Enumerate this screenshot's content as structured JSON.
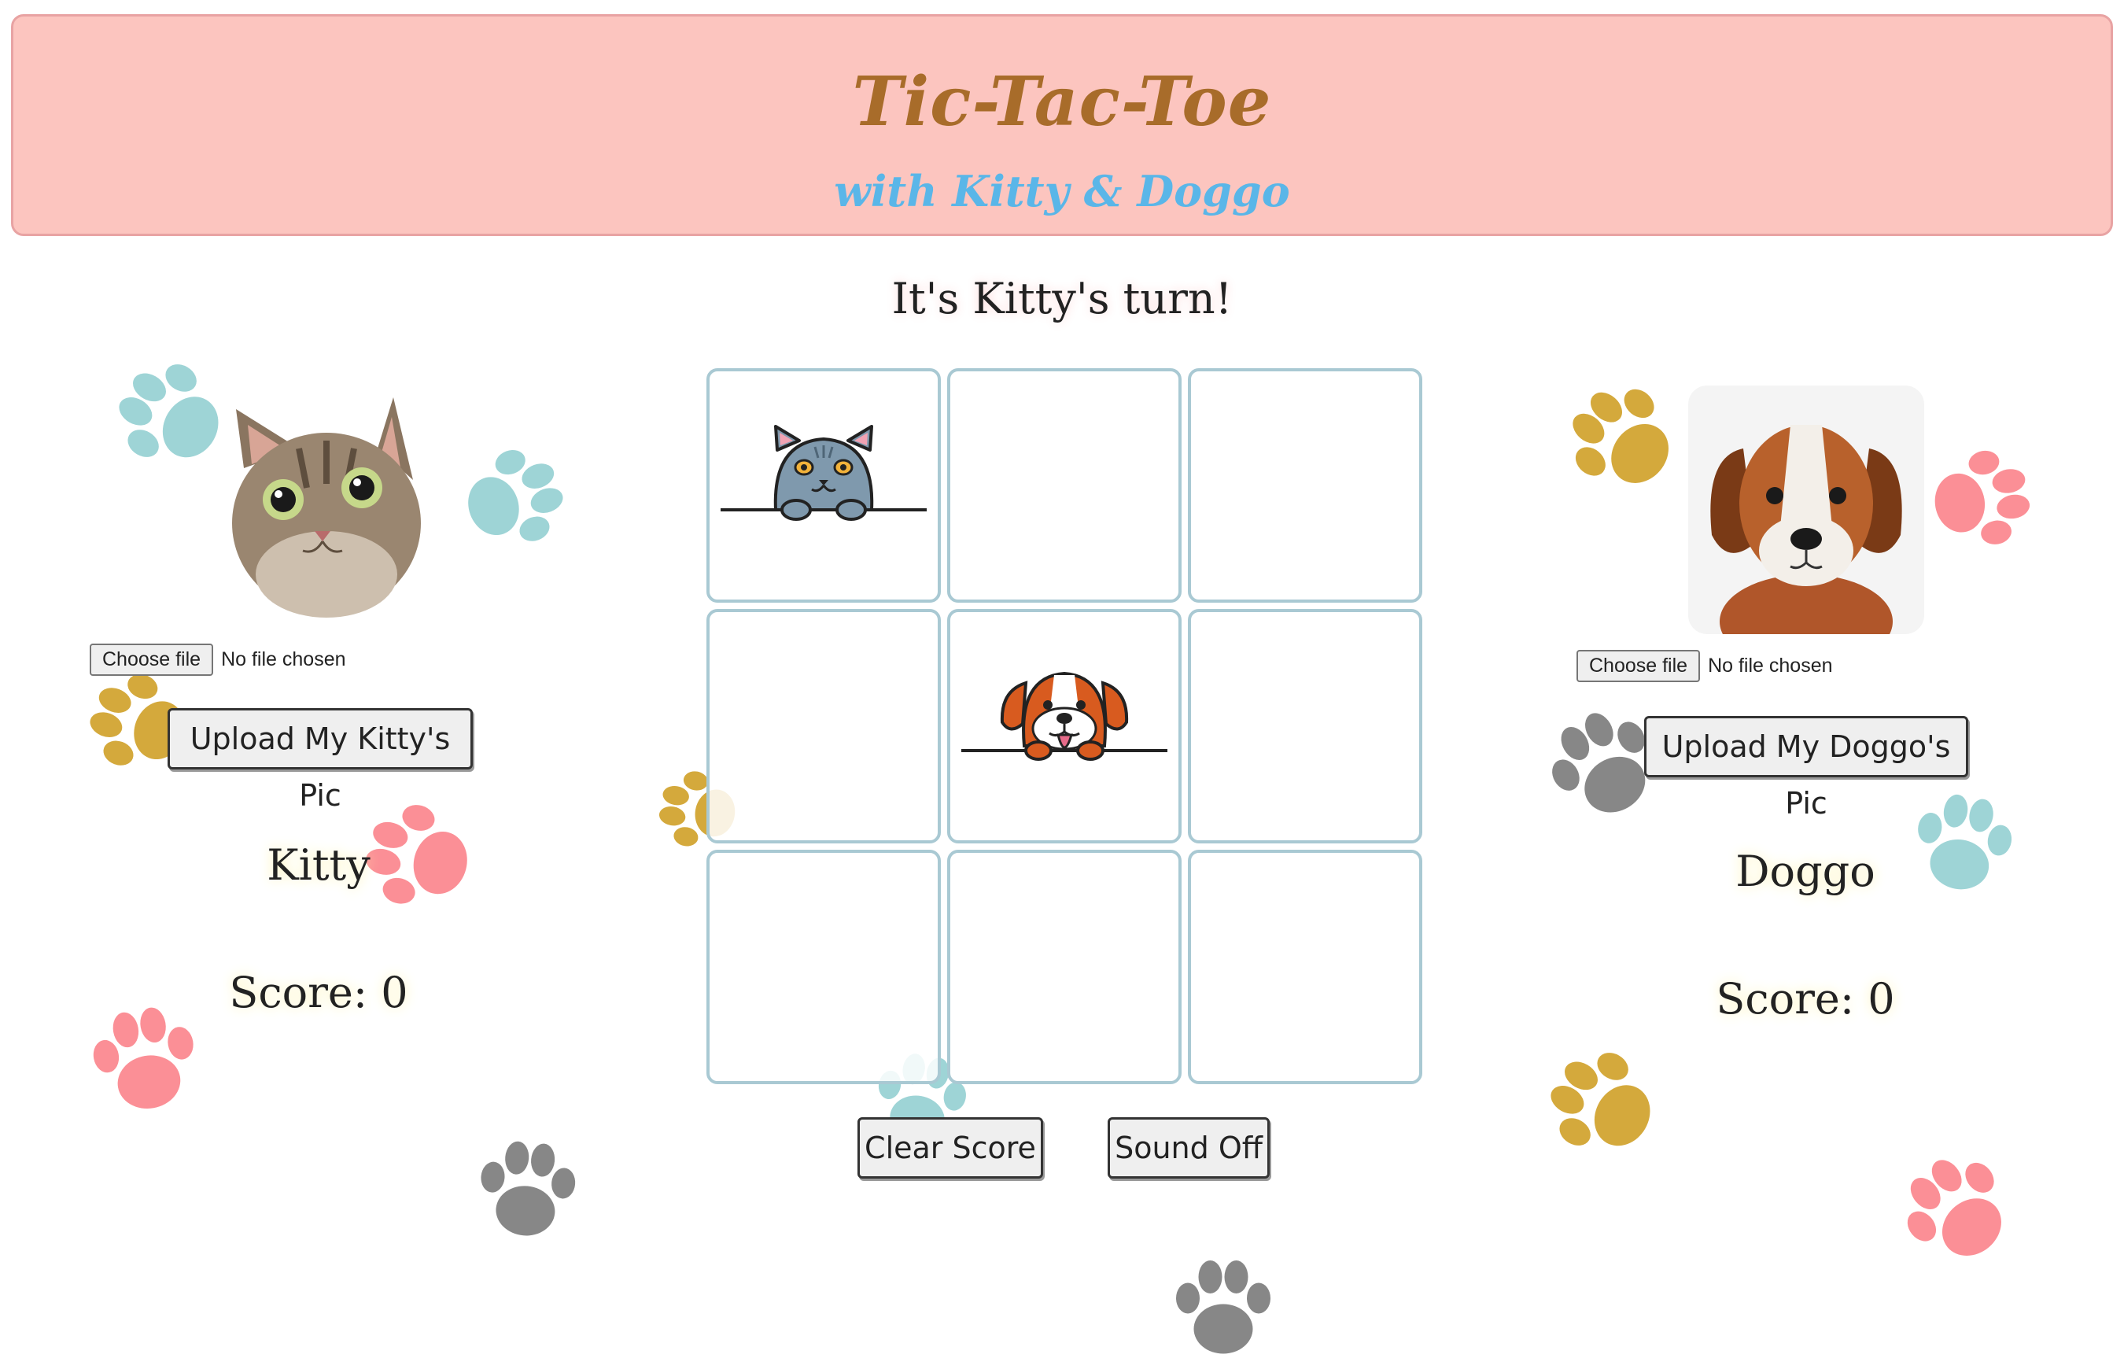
{
  "header": {
    "title": "Tic-Tac-Toe",
    "subtitle": "with Kitty & Doggo"
  },
  "status": "It's Kitty's turn!",
  "board": {
    "cells": [
      "kitty",
      "",
      "",
      "",
      "doggo",
      "",
      "",
      "",
      ""
    ]
  },
  "players": {
    "kitty": {
      "file_button": "Choose file",
      "file_status": "No file chosen",
      "upload_label": "Upload My Kitty's Pic",
      "name": "Kitty",
      "score": "Score: 0"
    },
    "doggo": {
      "file_button": "Choose file",
      "file_status": "No file chosen",
      "upload_label": "Upload My Doggo's Pic",
      "name": "Doggo",
      "score": "Score: 0"
    }
  },
  "controls": {
    "clear_score": "Clear Score",
    "sound": "Sound Off"
  },
  "colors": {
    "header_bg": "#fcc5bf",
    "title": "#a86c2a",
    "subtitle": "#5ab6e8",
    "cell_border": "#a9c9d3",
    "paw_teal": "#9ed4d6",
    "paw_gold": "#d4a93c",
    "paw_pink": "#fb8f96",
    "paw_gray": "#878787"
  }
}
